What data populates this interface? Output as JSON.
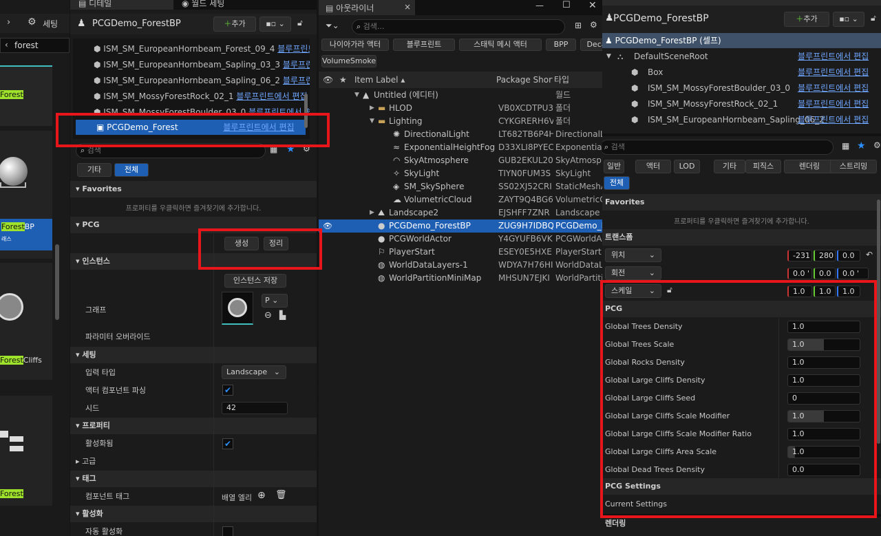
{
  "colors": {
    "accent": "#1e5fb4",
    "highlight": "#9fe22b",
    "red": "#e8151b",
    "link": "#6fa6ff"
  },
  "left_strip": {
    "settings_label": "세팅",
    "search_value": "forest",
    "tiles": [
      {
        "prefix": "",
        "hl": "Forest",
        "suffix": ""
      },
      {
        "prefix": "",
        "hl": "Forest",
        "suffix": "BP"
      },
      {
        "prefix": "",
        "hl": "Forest",
        "suffix": "Cliffs"
      },
      {
        "prefix": "",
        "hl": "Forest",
        "suffix": ""
      }
    ],
    "tile_sub": "래스"
  },
  "details": {
    "tab_details": "디테일",
    "tab_world": "월드 세팅",
    "actor_name": "PCGDemo_ForestBP",
    "add_label": "추가",
    "components": [
      {
        "name": "ISM_SM_EuropeanHornbeam_Forest_09_4",
        "link": "블루프린트에서 편집"
      },
      {
        "name": "ISM_SM_EuropeanHornbeam_Sapling_03_3",
        "link": "블루프린트에서 편집"
      },
      {
        "name": "ISM_SM_EuropeanHornbeam_Sapling_06_2",
        "link": "블루프린트에서 편집"
      },
      {
        "name": "ISM_SM_MossyForestRock_02_1",
        "link": "블루프린트에서 편집"
      },
      {
        "name": "ISM_SM_MossyForestBoulder_03_0",
        "link": "블루프린트에서 편집"
      }
    ],
    "selected_component": {
      "name": "PCGDemo_Forest",
      "link": "블루프린트에서 편집"
    },
    "search_placeholder": "검색",
    "filter_other": "기타",
    "filter_all": "전체",
    "sec_favorites": "Favorites",
    "favorites_hint": "프로퍼티를 우클릭하면 즐겨찾기에 추가합니다.",
    "sec_pcg": "PCG",
    "btn_generate": "생성",
    "btn_cleanup": "정리",
    "sec_instance": "인스턴스",
    "btn_save_instance": "인스턴스 저장",
    "graph_label": "그래프",
    "graph_select": "P",
    "param_override": "파라미터 오버라이드",
    "sec_settings": "세팅",
    "input_type_label": "입력 타입",
    "input_type_value": "Landscape",
    "parse_actor_label": "액터 컴포넌트 파싱",
    "seed_label": "시드",
    "seed_value": "42",
    "sec_property": "프로퍼티",
    "activated_label": "활성화됨",
    "sec_advanced": "고급",
    "sec_tag": "태그",
    "component_tag_label": "컴포넌트 태그",
    "component_tag_value": "배열 엘리먼트",
    "sec_activation": "활성화",
    "auto_activate_label": "자동 활성화"
  },
  "outliner": {
    "tab": "아웃라이너",
    "search_placeholder": "검색...",
    "filters": [
      "나이아가라 액터",
      "블루프린트",
      "스태틱 메시 액터",
      "BPP",
      "Decal",
      "VolumeSmoke"
    ],
    "col_label": "Item Label",
    "col_package": "Package Short",
    "col_type": "타입",
    "rows": [
      {
        "indent": 0,
        "icon": "level",
        "label": "Untitled (에디터)",
        "pkg": "",
        "type": "월드",
        "exp": "▼"
      },
      {
        "indent": 1,
        "icon": "folder",
        "label": "HLOD",
        "pkg": "VB0XCDTPU3",
        "type": "폴더",
        "exp": "▶"
      },
      {
        "indent": 1,
        "icon": "folder",
        "label": "Lighting",
        "pkg": "CYKGRERH6V",
        "type": "폴더",
        "exp": "▼"
      },
      {
        "indent": 2,
        "icon": "light",
        "label": "DirectionalLight",
        "pkg": "LT682TB6P4H",
        "type": "DirectionalLi",
        "exp": ""
      },
      {
        "indent": 2,
        "icon": "fog",
        "label": "ExponentialHeightFog",
        "pkg": "D33XLI8PYEC",
        "type": "Exponential",
        "exp": ""
      },
      {
        "indent": 2,
        "icon": "sky",
        "label": "SkyAtmosphere",
        "pkg": "GUB2EKUL20",
        "type": "SkyAtmosph",
        "exp": ""
      },
      {
        "indent": 2,
        "icon": "skylight",
        "label": "SkyLight",
        "pkg": "TIYN0FUM3S",
        "type": "SkyLight",
        "exp": ""
      },
      {
        "indent": 2,
        "icon": "mesh",
        "label": "SM_SkySphere",
        "pkg": "SS02XJ52CRI",
        "type": "StaticMeshA",
        "exp": ""
      },
      {
        "indent": 2,
        "icon": "cloud",
        "label": "VolumetricCloud",
        "pkg": "ZAYT9Q4BG6",
        "type": "VolumetricC",
        "exp": ""
      },
      {
        "indent": 1,
        "icon": "landscape",
        "label": "Landscape2",
        "pkg": "EJSHFF7ZNR",
        "type": "Landscape",
        "exp": "▶"
      },
      {
        "indent": 1,
        "icon": "actor",
        "label": "PCGDemo_ForestBP",
        "pkg": "ZUG9H7IDBQ",
        "type": "PCGDemo_F",
        "exp": "",
        "selected": true
      },
      {
        "indent": 1,
        "icon": "actor",
        "label": "PCGWorldActor",
        "pkg": "Y4GYUFB6VK",
        "type": "PCGWorldAc",
        "exp": ""
      },
      {
        "indent": 1,
        "icon": "player",
        "label": "PlayerStart",
        "pkg": "ESEY0E5HXE",
        "type": "PlayerStart",
        "exp": ""
      },
      {
        "indent": 1,
        "icon": "globe",
        "label": "WorldDataLayers-1",
        "pkg": "WDYA7H76HI",
        "type": "WorldDataL",
        "exp": ""
      },
      {
        "indent": 1,
        "icon": "globe",
        "label": "WorldPartitionMiniMap",
        "pkg": "MHSUN7EJKI",
        "type": "WorldPartitio",
        "exp": ""
      }
    ]
  },
  "right": {
    "tab_world": "월드 세팅",
    "tab_details": "디테일",
    "actor_name": "PCGDemo_ForestBP",
    "add_label": "추가",
    "self_row": "PCGDemo_ForestBP (셀프)",
    "tree": [
      {
        "indent": 1,
        "label": "DefaultSceneRoot",
        "link": "블루프린트에서 편집"
      },
      {
        "indent": 2,
        "label": "Box",
        "link": "블루프린트에서 편집"
      },
      {
        "indent": 2,
        "label": "ISM_SM_MossyForestBoulder_03_0",
        "link": "블루프린트에서 편집"
      },
      {
        "indent": 2,
        "label": "ISM_SM_MossyForestRock_02_1",
        "link": "블루프린트에서 편집"
      },
      {
        "indent": 2,
        "label": "ISM_SM_EuropeanHornbeam_Sapling_06_2",
        "link": "블루프린트에서 편집"
      }
    ],
    "search_placeholder": "검색",
    "filters": [
      "일반",
      "액터",
      "LOD",
      "기타",
      "피직스",
      "렌더링",
      "스트리밍"
    ],
    "filter_all": "전체",
    "sec_favorites": "Favorites",
    "favorites_hint": "프로퍼티를 우클릭하면 즐겨찾기에 추가합니다.",
    "sec_transform": "트랜스폼",
    "location_label": "위치",
    "location": [
      "-231",
      "280",
      "0.0"
    ],
    "rotation_label": "회전",
    "rotation": [
      "0.0 '",
      "0.0",
      "0.0 '"
    ],
    "scale_label": "스케일",
    "scale": [
      "1.0",
      "1.0",
      "1.0"
    ],
    "sec_pcg": "PCG",
    "params": [
      {
        "label": "Global Trees Density",
        "value": "1.0",
        "fill": 0.0
      },
      {
        "label": "Global Trees Scale",
        "value": "1.0",
        "fill": 0.5
      },
      {
        "label": "Global Rocks Density",
        "value": "1.0",
        "fill": 0.0
      },
      {
        "label": "Global Large Cliffs Density",
        "value": "1.0",
        "fill": 0.0
      },
      {
        "label": "Global Large Cliffs Seed",
        "value": "0",
        "fill": 0.0
      },
      {
        "label": "Global Large Cliffs Scale Modifier",
        "value": "1.0",
        "fill": 0.5
      },
      {
        "label": "Global Large Cliffs Scale Modifier Ratio",
        "value": "1.0",
        "fill": 0.0
      },
      {
        "label": "Global Large Cliffs Area Scale",
        "value": "1.0",
        "fill": 0.1
      },
      {
        "label": "Global Dead Trees Density",
        "value": "0.0",
        "fill": 0.0
      }
    ],
    "sec_pcg_settings": "PCG Settings",
    "current_settings": "Current Settings",
    "sec_render": "렌더링"
  }
}
